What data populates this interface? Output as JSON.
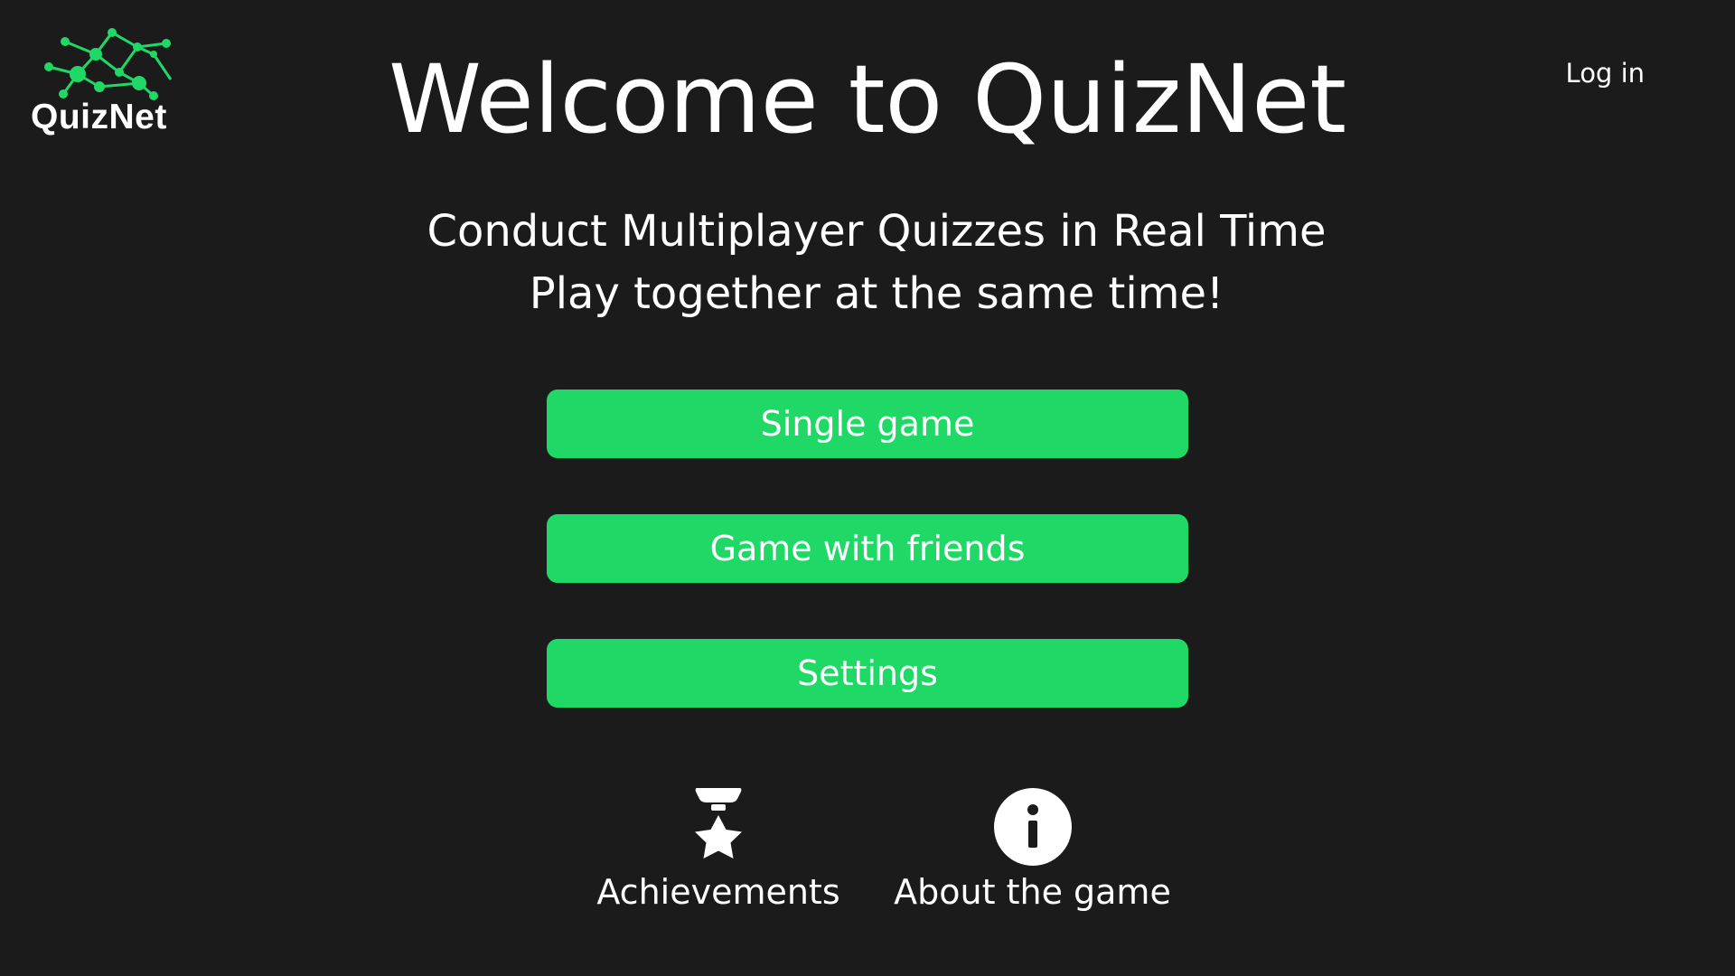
{
  "header": {
    "logo_text": "QuizNet",
    "login_label": "Log in"
  },
  "main": {
    "title": "Welcome to QuizNet",
    "subtitle_line1": "Conduct Multiplayer Quizzes in Real Time",
    "subtitle_line2": "Play together at the same time!"
  },
  "menu": {
    "single_game": "Single game",
    "game_with_friends": "Game with friends",
    "settings": "Settings"
  },
  "bottom": {
    "achievements_label": "Achievements",
    "achievements_icon": "medal-star-icon",
    "about_label": "About the game",
    "about_icon": "info-icon"
  },
  "colors": {
    "background": "#1b1b1b",
    "accent": "#20d866",
    "text": "#ffffff"
  }
}
